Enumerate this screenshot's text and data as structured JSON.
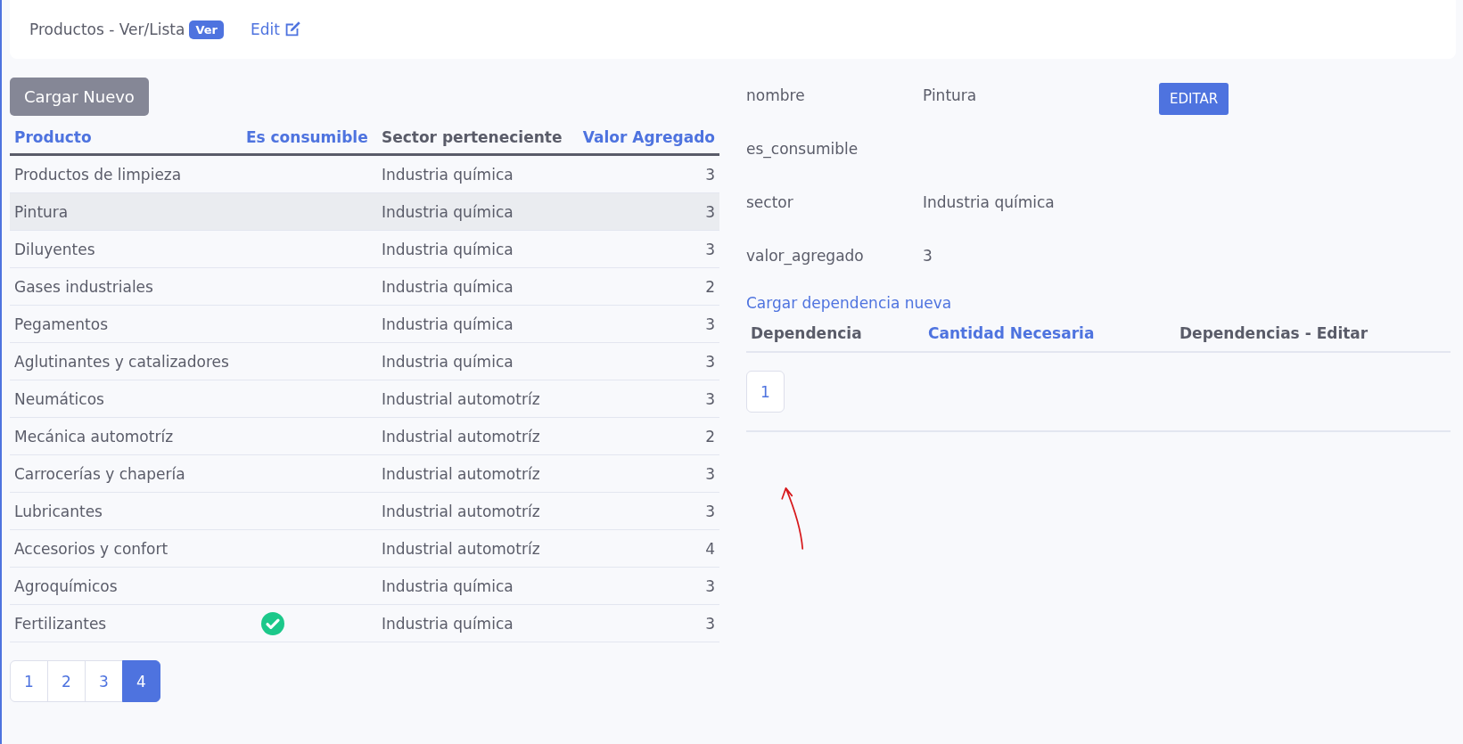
{
  "header": {
    "title": "Productos - Ver/Lista",
    "badge": "Ver",
    "edit_link": "Edit"
  },
  "new_button": "Cargar Nuevo",
  "table": {
    "columns": [
      {
        "label": "Producto",
        "kind": "sortable"
      },
      {
        "label": "Es consumible",
        "kind": "sortable"
      },
      {
        "label": "Sector perteneciente",
        "kind": "plain"
      },
      {
        "label": "Valor Agregado",
        "kind": "sortable"
      }
    ],
    "rows": [
      {
        "producto": "Productos de limpieza",
        "consumible": false,
        "sector": "Industria química",
        "valor": "3",
        "selected": false
      },
      {
        "producto": "Pintura",
        "consumible": false,
        "sector": "Industria química",
        "valor": "3",
        "selected": true
      },
      {
        "producto": "Diluyentes",
        "consumible": false,
        "sector": "Industria química",
        "valor": "3",
        "selected": false
      },
      {
        "producto": "Gases industriales",
        "consumible": false,
        "sector": "Industria química",
        "valor": "2",
        "selected": false
      },
      {
        "producto": "Pegamentos",
        "consumible": false,
        "sector": "Industria química",
        "valor": "3",
        "selected": false
      },
      {
        "producto": "Aglutinantes y catalizadores",
        "consumible": false,
        "sector": "Industria química",
        "valor": "3",
        "selected": false
      },
      {
        "producto": "Neumáticos",
        "consumible": false,
        "sector": "Industrial automotríz",
        "valor": "3",
        "selected": false
      },
      {
        "producto": "Mecánica automotríz",
        "consumible": false,
        "sector": "Industrial automotríz",
        "valor": "2",
        "selected": false
      },
      {
        "producto": "Carrocerías y chapería",
        "consumible": false,
        "sector": "Industrial automotríz",
        "valor": "3",
        "selected": false
      },
      {
        "producto": "Lubricantes",
        "consumible": false,
        "sector": "Industrial automotríz",
        "valor": "3",
        "selected": false
      },
      {
        "producto": "Accesorios y confort",
        "consumible": false,
        "sector": "Industrial automotríz",
        "valor": "4",
        "selected": false
      },
      {
        "producto": "Agroquímicos",
        "consumible": false,
        "sector": "Industria química",
        "valor": "3",
        "selected": false
      },
      {
        "producto": "Fertilizantes",
        "consumible": true,
        "sector": "Industria química",
        "valor": "3",
        "selected": false
      }
    ]
  },
  "pagination": [
    {
      "label": "1",
      "selected": false
    },
    {
      "label": "2",
      "selected": false
    },
    {
      "label": "3",
      "selected": false
    },
    {
      "label": "4",
      "selected": true
    }
  ],
  "detail": {
    "fields": [
      {
        "label": "nombre",
        "value": "Pintura"
      },
      {
        "label": "es_consumible"
      },
      {
        "label": "sector",
        "value": "Industria química"
      },
      {
        "label": "valor_agregado",
        "value": "3"
      }
    ],
    "edit_button": "EDITAR",
    "new_dependency_link": "Cargar dependencia nueva",
    "dependency_columns": [
      {
        "label": "Dependencia",
        "kind": "plain"
      },
      {
        "label": "Cantidad Necesaria",
        "kind": "sortable"
      },
      {
        "label": "Dependencias - Editar",
        "kind": "plain"
      }
    ],
    "pagination": [
      {
        "label": "1",
        "selected": false
      }
    ]
  }
}
